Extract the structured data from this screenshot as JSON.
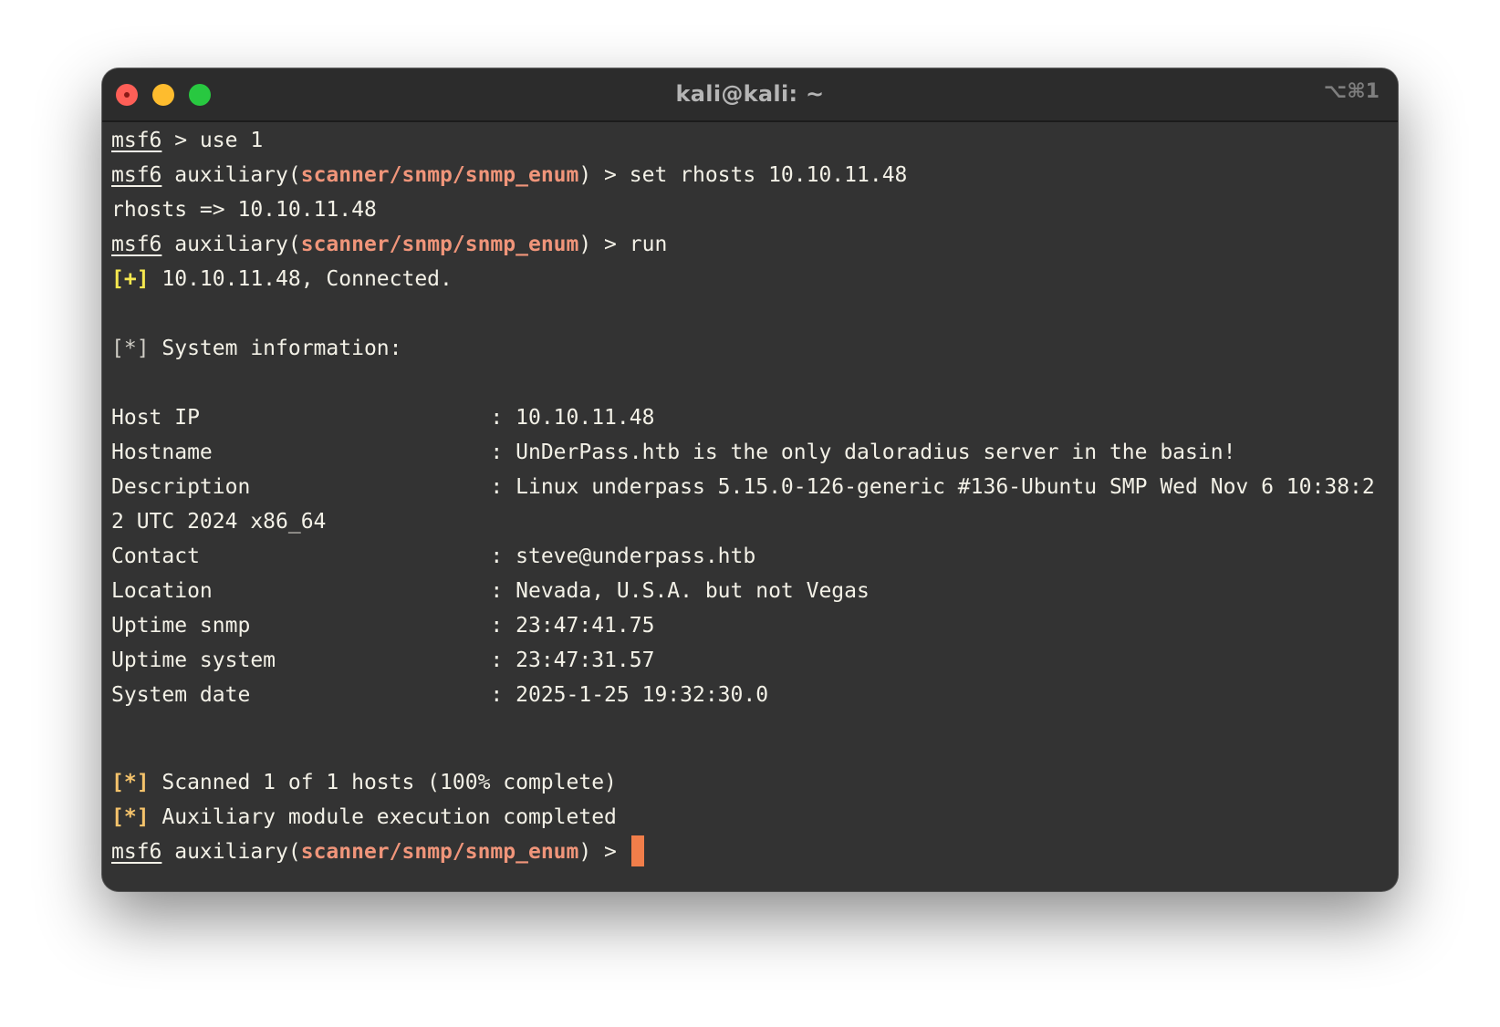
{
  "window": {
    "title": "kali@kali: ~",
    "shortcut": "⌥⌘1",
    "accent_colors": {
      "module": "#f0957a",
      "success": "#f6e84f",
      "status": "#f5c36b",
      "cursor": "#f17e4a",
      "background": "#333333"
    }
  },
  "terminal": {
    "prompt": "msf6",
    "module_prefix": " auxiliary(",
    "module_name": "scanner/snmp/snmp_enum",
    "module_suffix": ") > ",
    "line1_cmd": " > use 1",
    "line2_cmd": "set rhosts 10.10.11.48",
    "line3": "rhosts => 10.10.11.48",
    "line4_cmd": "run",
    "connected_tag": "[+]",
    "connected_text": " 10.10.11.48, Connected.",
    "sysinfo_tag": "[*]",
    "sysinfo_text": " System information:",
    "info_rows": [
      {
        "key": "Host IP                       ",
        "sep": ": ",
        "value": "10.10.11.48"
      },
      {
        "key": "Hostname                      ",
        "sep": ": ",
        "value": "UnDerPass.htb is the only daloradius server in the basin!"
      },
      {
        "key": "Description                   ",
        "sep": ": ",
        "value": "Linux underpass 5.15.0-126-generic #136-Ubuntu SMP Wed Nov 6 10:38:2"
      },
      {
        "key": "",
        "sep": "",
        "value": "2 UTC 2024 x86_64"
      },
      {
        "key": "Contact                       ",
        "sep": ": ",
        "value": "steve@underpass.htb"
      },
      {
        "key": "Location                      ",
        "sep": ": ",
        "value": "Nevada, U.S.A. but not Vegas"
      },
      {
        "key": "Uptime snmp                   ",
        "sep": ": ",
        "value": "23:47:41.75"
      },
      {
        "key": "Uptime system                 ",
        "sep": ": ",
        "value": "23:47:31.57"
      },
      {
        "key": "System date                   ",
        "sep": ": ",
        "value": "2025-1-25 19:32:30.0"
      }
    ],
    "scan_tag": "[*]",
    "scan_text": " Scanned 1 of 1 hosts (100% complete)",
    "done_tag": "[*]",
    "done_text": " Auxiliary module execution completed"
  }
}
